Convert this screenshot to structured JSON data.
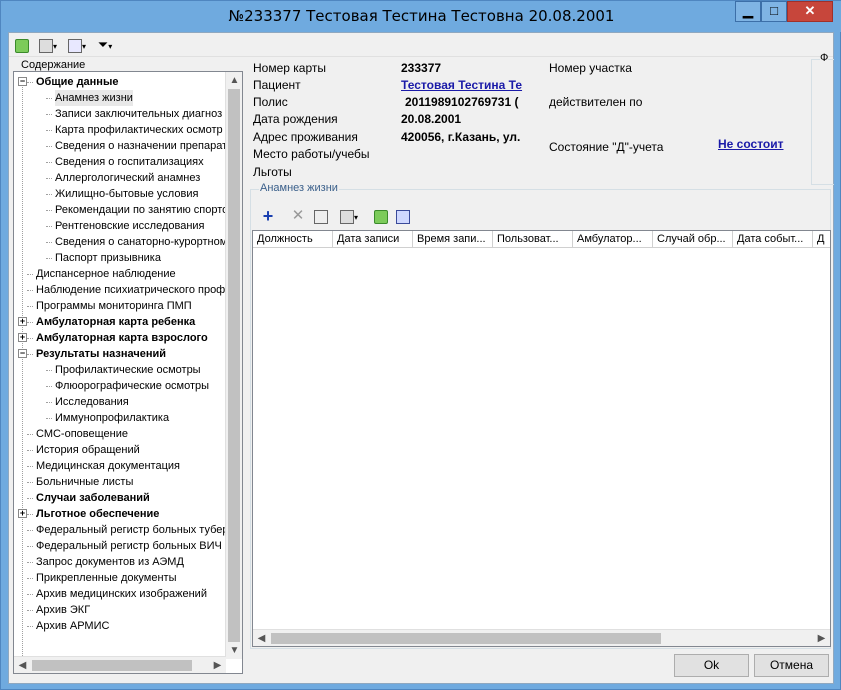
{
  "window": {
    "title": "№233377 Тестовая Тестина Тестовна 20.08.2001"
  },
  "toolbar": {
    "filter_glyph": "▼"
  },
  "tree": {
    "label": "Содержание",
    "items": [
      {
        "text": "Общие данные",
        "bold": true,
        "level": 0,
        "expander": "-"
      },
      {
        "text": "Анамнез жизни",
        "bold": false,
        "level": 1,
        "selected": true
      },
      {
        "text": "Записи заключительных диагноз",
        "bold": false,
        "level": 1
      },
      {
        "text": "Карта профилактических осмотр",
        "bold": false,
        "level": 1
      },
      {
        "text": "Сведения о назначении препарат",
        "bold": false,
        "level": 1
      },
      {
        "text": "Сведения о госпитализациях",
        "bold": false,
        "level": 1
      },
      {
        "text": "Аллергологический анамнез",
        "bold": false,
        "level": 1
      },
      {
        "text": "Жилищно-бытовые условия",
        "bold": false,
        "level": 1
      },
      {
        "text": "Рекомендации по занятию спорто",
        "bold": false,
        "level": 1
      },
      {
        "text": "Рентгеновские исследования",
        "bold": false,
        "level": 1
      },
      {
        "text": "Сведения о санаторно-курортном л",
        "bold": false,
        "level": 1
      },
      {
        "text": "Паспорт призывника",
        "bold": false,
        "level": 1
      },
      {
        "text": "Диспансерное наблюдение",
        "bold": false,
        "level": 0
      },
      {
        "text": "Наблюдение психиатрического проф",
        "bold": false,
        "level": 0
      },
      {
        "text": "Программы мониторинга ПМП",
        "bold": false,
        "level": 0
      },
      {
        "text": "Амбулаторная карта ребенка",
        "bold": true,
        "level": 0,
        "expander": "+"
      },
      {
        "text": "Амбулаторная карта взрослого",
        "bold": true,
        "level": 0,
        "expander": "+"
      },
      {
        "text": "Результаты назначений",
        "bold": true,
        "level": 0,
        "expander": "-"
      },
      {
        "text": "Профилактические осмотры",
        "bold": false,
        "level": 1
      },
      {
        "text": "Флюорографические осмотры",
        "bold": false,
        "level": 1
      },
      {
        "text": "Исследования",
        "bold": false,
        "level": 1
      },
      {
        "text": "Иммунопрофилактика",
        "bold": false,
        "level": 1
      },
      {
        "text": "СМС-оповещение",
        "bold": false,
        "level": 0
      },
      {
        "text": "История обращений",
        "bold": false,
        "level": 0
      },
      {
        "text": "Медицинская документация",
        "bold": false,
        "level": 0
      },
      {
        "text": "Больничные листы",
        "bold": false,
        "level": 0
      },
      {
        "text": "Случаи заболеваний",
        "bold": true,
        "level": 0
      },
      {
        "text": "Льготное обеспечение",
        "bold": true,
        "level": 0,
        "expander": "+"
      },
      {
        "text": "Федеральный регистр больных тубер",
        "bold": false,
        "level": 0
      },
      {
        "text": "Федеральный регистр больных ВИЧ",
        "bold": false,
        "level": 0
      },
      {
        "text": "Запрос документов из АЭМД",
        "bold": false,
        "level": 0
      },
      {
        "text": "Прикрепленные документы",
        "bold": false,
        "level": 0
      },
      {
        "text": "Архив медицинских изображений",
        "bold": false,
        "level": 0
      },
      {
        "text": "Архив ЭКГ",
        "bold": false,
        "level": 0
      },
      {
        "text": "Архив АРМИС",
        "bold": false,
        "level": 0
      }
    ]
  },
  "patient": {
    "card_label": "Номер карты",
    "card_value": "233377",
    "patient_label": "Пациент",
    "patient_value": "Тестовая Тестина Те",
    "policy_label": "Полис",
    "policy_value": "2011989102769731 (",
    "dob_label": "Дата рождения",
    "dob_value": "20.08.2001",
    "address_label": "Адрес проживания",
    "address_value": "420056, г.Казань, ул.",
    "work_label": "Место работы/учебы",
    "benefits_label": "Льготы",
    "district_label": "Номер участка",
    "valid_label": "действителен по",
    "d_state_label": "Состояние \"Д\"-учета",
    "d_state_value": "Не состоит",
    "f_group_label": "Ф"
  },
  "anamnesis": {
    "group_title": "Анамнез жизни",
    "columns": [
      "Должность",
      "Дата записи",
      "Время запи...",
      "Пользоват...",
      "Амбулатор...",
      "Случай обр...",
      "Дата событ...",
      "Д"
    ]
  },
  "buttons": {
    "ok": "Ok",
    "cancel": "Отмена"
  }
}
